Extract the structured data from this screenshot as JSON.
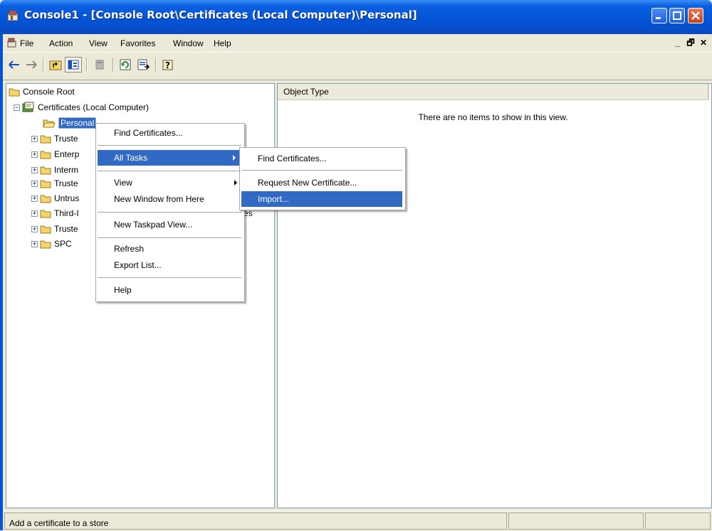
{
  "window": {
    "title": "Console1 - [Console Root\\Certificates (Local Computer)\\Personal]",
    "accent": "#0453d6",
    "icons": [
      "mmc-app-icon",
      "minimize-icon",
      "maximize-icon",
      "close-icon"
    ]
  },
  "menubar": {
    "items": [
      "File",
      "Action",
      "View",
      "Favorites",
      "Window",
      "Help"
    ],
    "mdi_controls": [
      "_",
      "🗗",
      "✕"
    ]
  },
  "toolbar": {
    "buttons": [
      "back-icon",
      "forward-icon",
      "up-one-level-icon",
      "show-hide-tree-icon",
      "delete-icon",
      "refresh-icon",
      "export-list-icon",
      "help-icon"
    ]
  },
  "tree": {
    "root": "Console Root",
    "certificates": "Certificates (Local Computer)",
    "personal": "Personal",
    "stores": [
      "Truste",
      "Enterp",
      "Interm",
      "Truste",
      "Untrus",
      "Third-I",
      "Truste",
      "SPC"
    ],
    "overflow_fragment": "es"
  },
  "list_view": {
    "column_header": "Object Type",
    "empty_message": "There are no items to show in this view."
  },
  "context_menu": {
    "find_certificates": "Find Certificates...",
    "all_tasks": "All Tasks",
    "view": "View",
    "new_window": "New Window from Here",
    "new_taskpad": "New Taskpad View...",
    "refresh": "Refresh",
    "export_list": "Export List...",
    "help": "Help"
  },
  "submenu": {
    "find_certificates": "Find Certificates...",
    "request_new": "Request New Certificate...",
    "import": "Import..."
  },
  "status": {
    "text": "Add a certificate to a store"
  },
  "colors": {
    "selection": "#316ac5",
    "chrome": "#ece9d8",
    "folder": "#f5d46a"
  }
}
